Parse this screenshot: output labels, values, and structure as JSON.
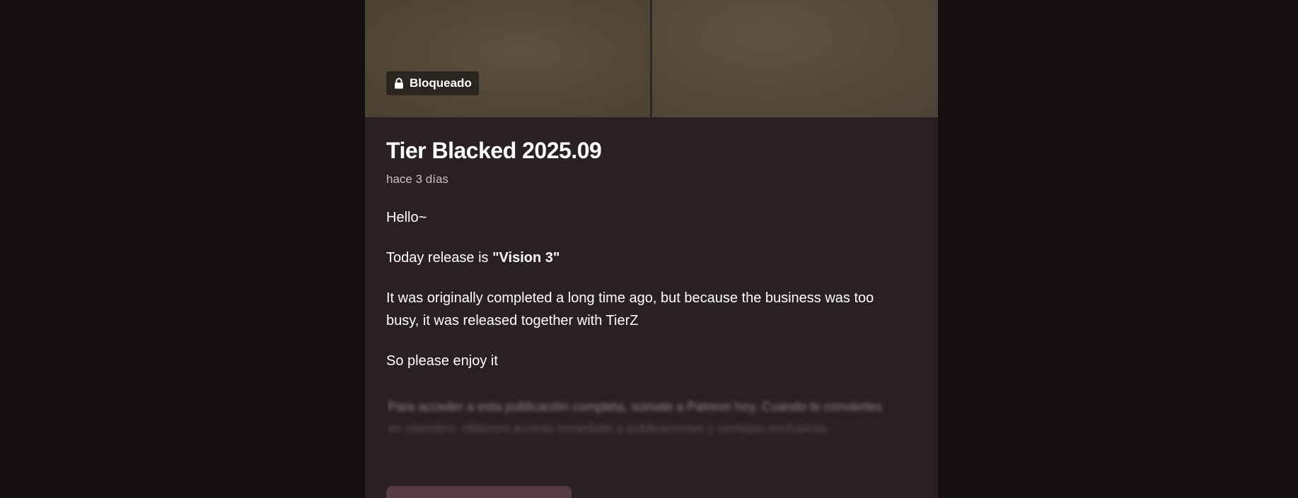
{
  "post": {
    "locked_badge": {
      "label": "Bloqueado",
      "icon": "lock-icon"
    },
    "title": "Tier Blacked 2025.09",
    "timestamp": "hace 3 días",
    "body": {
      "greeting": "Hello~",
      "release_prefix": "Today release is ",
      "release_name": "\"Vision 3\"",
      "note": "It was originally completed a long time ago, but because the business was too busy, it was released together with TierZ",
      "closing": "So please enjoy it"
    },
    "teaser": "Para acceder a esta publicación completa, súmate a Patreon hoy. Cuando te conviertes en miembro, obtienes acceso inmediato a publicaciones y ventajas exclusivas."
  },
  "colors": {
    "page_background": "#141012",
    "card_background": "#2a2022",
    "button_background": "#553c42",
    "text_primary": "#ffffff",
    "text_secondary": "#c9bfc1"
  }
}
